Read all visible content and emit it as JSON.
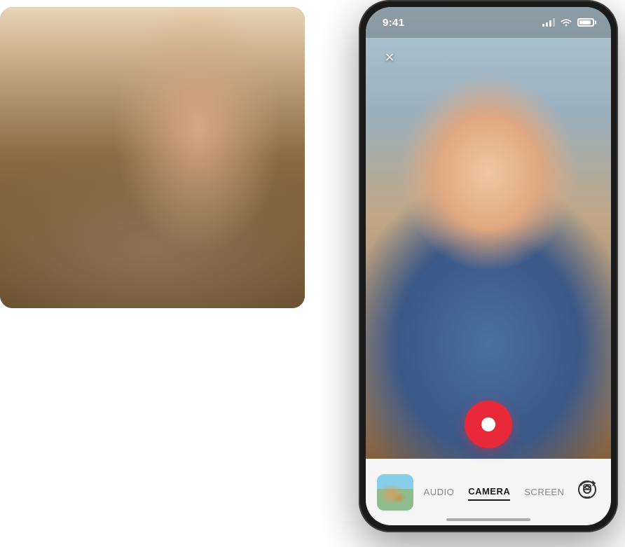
{
  "leftPhoto": {
    "alt": "Woman with headphones working on laptop"
  },
  "phone": {
    "statusBar": {
      "time": "9:41",
      "timeLabel": "current time"
    },
    "cameraView": {
      "alt": "Woman with headphones smiling at camera"
    },
    "closeButton": {
      "label": "×"
    },
    "recordButton": {
      "label": "Record"
    },
    "toolbar": {
      "tabs": [
        {
          "id": "audio",
          "label": "AUDIO",
          "active": false
        },
        {
          "id": "camera",
          "label": "CAMERA",
          "active": true
        },
        {
          "id": "screen",
          "label": "SCREEN",
          "active": false
        }
      ],
      "flipCameraLabel": "Flip camera"
    }
  }
}
